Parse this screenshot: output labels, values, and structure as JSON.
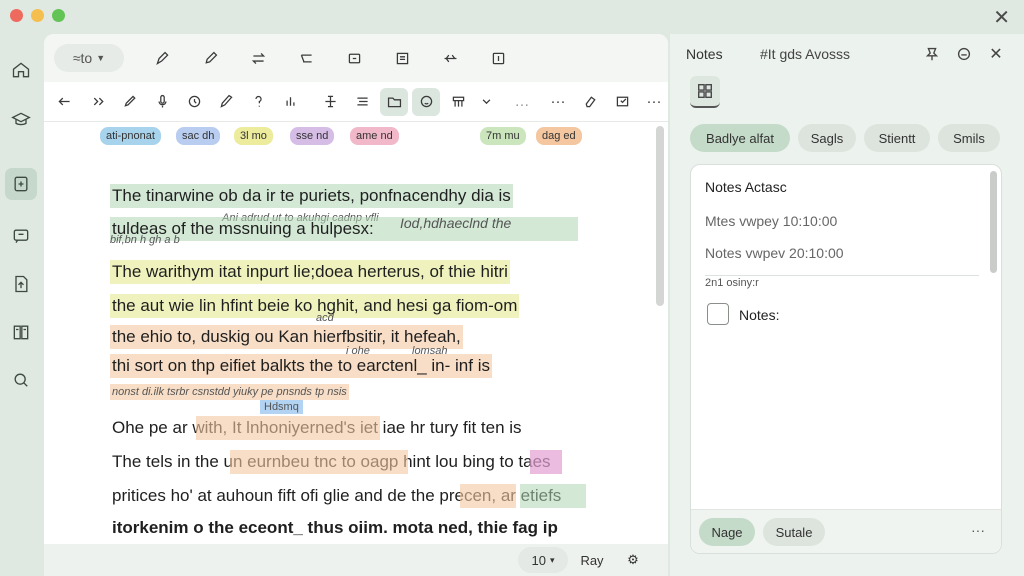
{
  "window": {
    "close_icon": "close-icon"
  },
  "rail": [
    {
      "name": "home-icon"
    },
    {
      "name": "graduation-cap-icon"
    },
    {
      "name": "note-icon"
    },
    {
      "name": "comment-icon"
    },
    {
      "name": "document-icon"
    },
    {
      "name": "book-icon"
    },
    {
      "name": "search-icon"
    }
  ],
  "toolbar": {
    "style_value": "≈to"
  },
  "chips": [
    {
      "label": "ati-pnonat",
      "color": "#a8d3ec"
    },
    {
      "label": "sac dh",
      "color": "#b8cdf0"
    },
    {
      "label": "3l mo",
      "color": "#ecec9c"
    },
    {
      "label": "sse nd",
      "color": "#d6bde6"
    },
    {
      "label": "ame nd",
      "color": "#f0b8c8"
    },
    {
      "label": "7m mu",
      "color": "#cbe6bd"
    },
    {
      "label": "dag ed",
      "color": "#f4c7a0"
    }
  ],
  "document": {
    "lines": [
      "The tinarwine ob da ir te puriets, ponfnacendhy dia is",
      "tuldeas of the mssnuing a hulpesx:",
      "The warithym itat inpurt lie;doea herterus, of thie hitri",
      "the aut wie lin hfint beie ko hghit, and hesi ga fiom-om",
      "the ehio to, duskig ou Kan hierfbsitir, it hefeah,",
      "thi sort on thp eifiet balkts the to earctenl_ in- inf is",
      "Ohe pe ar with, It lnhoniyerned's iet iae hr tury fit ten is",
      "The tels in the un eurnbeu tnc to oagp hint lou bing to taes",
      "pritices ho' at auhoun fift ofi glie and de the precen, ar etiefs",
      "itorkenim o the eceont_ thus oiim. mota ned, thie fag ip"
    ],
    "notes": [
      "Ani adrud ut to akuhgi cadnp vfli",
      "Iod,hdhaeclnd the",
      "bif,bn h gh a b",
      "acd",
      "i ohe",
      "lomsah",
      "nonst di.ilk tsrbr csnstdd yiuky pe pnsnds tp nsis",
      "Hdsmq"
    ]
  },
  "status": {
    "zoom": "10",
    "mode": "Ray"
  },
  "notes_panel": {
    "title": "Notes",
    "subtitle": "#It gds Avosss",
    "filters": [
      "Badlye alfat",
      "Sagls",
      "Stientt",
      "Smils"
    ],
    "card": {
      "title": "Notes Actasc",
      "line1": "Mtes vwpey 10:10:00",
      "line2": "Notes vwpev 20:10:00",
      "small": "2n1 osiny:r",
      "check_label": "Notes:"
    },
    "footer_buttons": [
      "Nage",
      "Sutale"
    ],
    "more": "···"
  }
}
